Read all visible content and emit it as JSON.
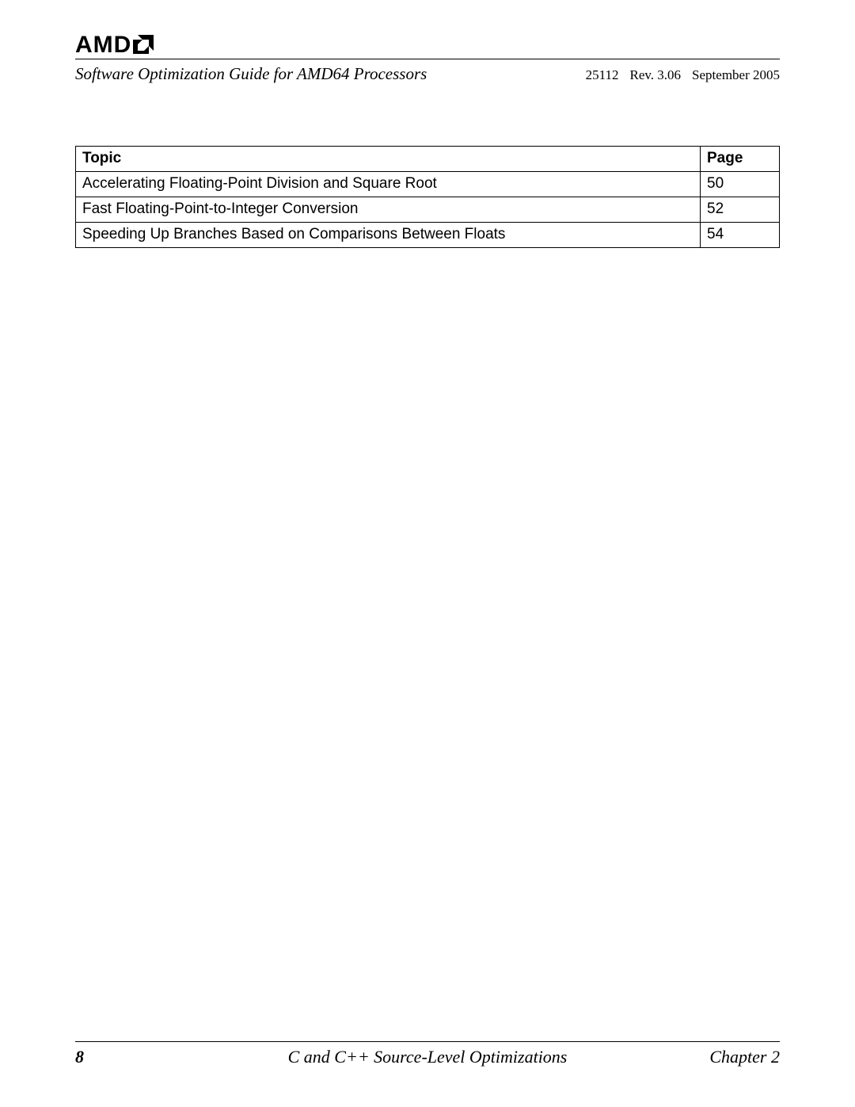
{
  "logo_text": "AMD",
  "header": {
    "title": "Software Optimization Guide for AMD64 Processors",
    "doc_number": "25112",
    "revision": "Rev. 3.06",
    "date": "September 2005"
  },
  "table": {
    "columns": {
      "topic": "Topic",
      "page": "Page"
    },
    "rows": [
      {
        "topic": "Accelerating Floating-Point Division and Square Root",
        "page": "50"
      },
      {
        "topic": "Fast Floating-Point-to-Integer Conversion",
        "page": "52"
      },
      {
        "topic": "Speeding Up Branches Based on Comparisons Between Floats",
        "page": "54"
      }
    ]
  },
  "footer": {
    "page_number": "8",
    "section_title": "C and C++ Source-Level Optimizations",
    "chapter": "Chapter 2"
  }
}
